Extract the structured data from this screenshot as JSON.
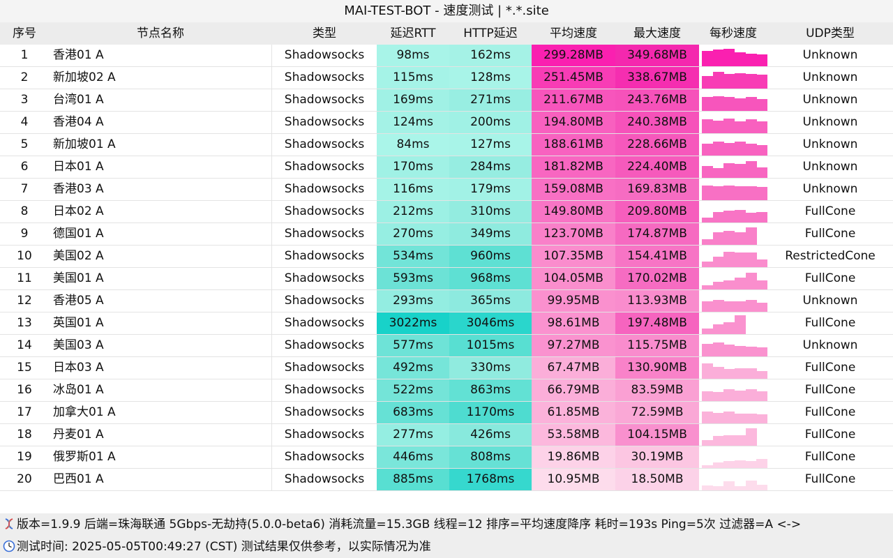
{
  "title": "MAI-TEST-BOT - 速度测试 | *.*.site",
  "headers": {
    "index": "序号",
    "name": "节点名称",
    "type": "类型",
    "rtt": "延迟RTT",
    "http": "HTTP延迟",
    "avg": "平均速度",
    "max": "最大速度",
    "persec": "每秒速度",
    "udp": "UDP类型"
  },
  "rows": [
    {
      "index": "1",
      "name": "香港01 A",
      "type": "Shadowsocks",
      "rtt": "98ms",
      "http": "162ms",
      "avg": "299.28MB",
      "max": "349.68MB",
      "udp": "Unknown",
      "rtt_color": "#a8f4e8",
      "http_color": "#a5f2e6",
      "avg_color": "#fa20b0",
      "max_color": "#f428ae",
      "spark": [
        0.8,
        0.85,
        0.9,
        0.7,
        0.65,
        0.6
      ]
    },
    {
      "index": "2",
      "name": "新加坡02 A",
      "type": "Shadowsocks",
      "rtt": "115ms",
      "http": "128ms",
      "avg": "251.45MB",
      "max": "338.67MB",
      "udp": "Unknown",
      "rtt_color": "#a5f3e7",
      "http_color": "#a8f4e8",
      "avg_color": "#f83cb5",
      "max_color": "#f52eb0",
      "spark": [
        0.65,
        0.85,
        0.75,
        0.8,
        0.75,
        0.7
      ]
    },
    {
      "index": "3",
      "name": "台湾01 A",
      "type": "Shadowsocks",
      "rtt": "169ms",
      "http": "271ms",
      "avg": "211.67MB",
      "max": "243.76MB",
      "udp": "Unknown",
      "rtt_color": "#a0f1e5",
      "http_color": "#98eee2",
      "avg_color": "#f755bc",
      "max_color": "#f652ba",
      "spark": [
        0.7,
        0.75,
        0.7,
        0.65,
        0.7,
        0.6
      ]
    },
    {
      "index": "4",
      "name": "香港04 A",
      "type": "Shadowsocks",
      "rtt": "124ms",
      "http": "200ms",
      "avg": "194.80MB",
      "max": "240.38MB",
      "udp": "Unknown",
      "rtt_color": "#a4f2e6",
      "http_color": "#a0f1e5",
      "avg_color": "#f860bf",
      "max_color": "#f652ba",
      "spark": [
        0.7,
        0.65,
        0.75,
        0.6,
        0.7,
        0.6
      ]
    },
    {
      "index": "5",
      "name": "新加坡01 A",
      "type": "Shadowsocks",
      "rtt": "84ms",
      "http": "127ms",
      "avg": "188.61MB",
      "max": "228.66MB",
      "udp": "Unknown",
      "rtt_color": "#aaf5e9",
      "http_color": "#a8f4e8",
      "avg_color": "#f862c0",
      "max_color": "#f658bc",
      "spark": [
        0.6,
        0.7,
        0.65,
        0.7,
        0.6,
        0.55
      ]
    },
    {
      "index": "6",
      "name": "日本01 A",
      "type": "Shadowsocks",
      "rtt": "170ms",
      "http": "284ms",
      "avg": "181.82MB",
      "max": "224.40MB",
      "udp": "Unknown",
      "rtt_color": "#a0f1e5",
      "http_color": "#96ede1",
      "avg_color": "#f866c1",
      "max_color": "#f65abc",
      "spark": [
        0.6,
        0.5,
        0.75,
        0.7,
        0.85,
        0.55
      ]
    },
    {
      "index": "7",
      "name": "香港03 A",
      "type": "Shadowsocks",
      "rtt": "116ms",
      "http": "179ms",
      "avg": "159.08MB",
      "max": "169.83MB",
      "udp": "Unknown",
      "rtt_color": "#a5f3e7",
      "http_color": "#a2f2e6",
      "avg_color": "#f870c4",
      "max_color": "#f66cc2",
      "spark": [
        0.75,
        0.7,
        0.75,
        0.7,
        0.72,
        0.68
      ]
    },
    {
      "index": "8",
      "name": "日本02 A",
      "type": "Shadowsocks",
      "rtt": "212ms",
      "http": "310ms",
      "avg": "149.80MB",
      "max": "209.80MB",
      "udp": "FullCone",
      "rtt_color": "#9cf0e4",
      "http_color": "#93ece0",
      "avg_color": "#f874c5",
      "max_color": "#f65ebd",
      "spark": [
        0.25,
        0.55,
        0.6,
        0.65,
        0.5,
        0.55
      ]
    },
    {
      "index": "9",
      "name": "德国01 A",
      "type": "Shadowsocks",
      "rtt": "270ms",
      "http": "349ms",
      "avg": "123.70MB",
      "max": "174.87MB",
      "udp": "FullCone",
      "rtt_color": "#96eee2",
      "http_color": "#8febdf",
      "avg_color": "#f980c9",
      "max_color": "#f66ac1",
      "spark": [
        0.3,
        0.65,
        0.7,
        0.65,
        0.9,
        0.0
      ]
    },
    {
      "index": "10",
      "name": "美国02 A",
      "type": "Shadowsocks",
      "rtt": "534ms",
      "http": "960ms",
      "avg": "107.35MB",
      "max": "154.41MB",
      "udp": "RestrictedCone",
      "rtt_color": "#72e4d8",
      "http_color": "#5ee0d3",
      "avg_color": "#fa8ccd",
      "max_color": "#f774c5",
      "spark": [
        0.3,
        0.55,
        0.8,
        0.75,
        0.75,
        0.4
      ]
    },
    {
      "index": "11",
      "name": "美国01 A",
      "type": "Shadowsocks",
      "rtt": "593ms",
      "http": "968ms",
      "avg": "104.05MB",
      "max": "170.02MB",
      "udp": "FullCone",
      "rtt_color": "#6ce2d6",
      "http_color": "#5ee0d3",
      "avg_color": "#fa8ecd",
      "max_color": "#f66cc2",
      "spark": [
        0.2,
        0.4,
        0.45,
        0.6,
        0.85,
        0.45
      ]
    },
    {
      "index": "12",
      "name": "香港05 A",
      "type": "Shadowsocks",
      "rtt": "293ms",
      "http": "365ms",
      "avg": "99.95MB",
      "max": "113.93MB",
      "udp": "Unknown",
      "rtt_color": "#93ede1",
      "http_color": "#8deadf",
      "avg_color": "#fa90ce",
      "max_color": "#f98ccd",
      "spark": [
        0.55,
        0.6,
        0.55,
        0.55,
        0.6,
        0.45
      ]
    },
    {
      "index": "13",
      "name": "英国01 A",
      "type": "Shadowsocks",
      "rtt": "3022ms",
      "http": "3046ms",
      "avg": "98.61MB",
      "max": "197.48MB",
      "udp": "FullCone",
      "rtt_color": "#18d2c9",
      "http_color": "#2ad6cc",
      "avg_color": "#fa92cf",
      "max_color": "#f664bf",
      "spark": [
        0.3,
        0.5,
        0.6,
        0.95,
        0.0,
        0.0
      ]
    },
    {
      "index": "14",
      "name": "美国03 A",
      "type": "Shadowsocks",
      "rtt": "577ms",
      "http": "1015ms",
      "avg": "97.27MB",
      "max": "115.75MB",
      "udp": "Unknown",
      "rtt_color": "#6ee3d7",
      "http_color": "#58dfd2",
      "avg_color": "#fa92cf",
      "max_color": "#f98ccd",
      "spark": [
        0.65,
        0.7,
        0.6,
        0.55,
        0.5,
        0.45
      ]
    },
    {
      "index": "15",
      "name": "日本03 A",
      "type": "Shadowsocks",
      "rtt": "492ms",
      "http": "330ms",
      "avg": "67.47MB",
      "max": "130.90MB",
      "udp": "FullCone",
      "rtt_color": "#76e5d9",
      "http_color": "#90ebdf",
      "avg_color": "#fbaed9",
      "max_color": "#f982c9",
      "spark": [
        0.8,
        0.6,
        0.5,
        0.55,
        0.55,
        0.4
      ]
    },
    {
      "index": "16",
      "name": "冰岛01 A",
      "type": "Shadowsocks",
      "rtt": "522ms",
      "http": "863ms",
      "avg": "66.79MB",
      "max": "83.59MB",
      "udp": "FullCone",
      "rtt_color": "#74e4d8",
      "http_color": "#62e1d4",
      "avg_color": "#fbaed9",
      "max_color": "#faa0d3",
      "spark": [
        0.5,
        0.45,
        0.6,
        0.55,
        0.6,
        0.5
      ]
    },
    {
      "index": "17",
      "name": "加拿大01 A",
      "type": "Shadowsocks",
      "rtt": "683ms",
      "http": "1170ms",
      "avg": "61.85MB",
      "max": "72.59MB",
      "udp": "FullCone",
      "rtt_color": "#66e1d5",
      "http_color": "#4edcd0",
      "avg_color": "#fbb2da",
      "max_color": "#faa8d6",
      "spark": [
        0.6,
        0.55,
        0.6,
        0.5,
        0.5,
        0.45
      ]
    },
    {
      "index": "18",
      "name": "丹麦01 A",
      "type": "Shadowsocks",
      "rtt": "277ms",
      "http": "426ms",
      "avg": "53.58MB",
      "max": "104.15MB",
      "udp": "FullCone",
      "rtt_color": "#95eee2",
      "http_color": "#88e9dd",
      "avg_color": "#fcb8dd",
      "max_color": "#f990ce",
      "spark": [
        0.3,
        0.5,
        0.55,
        0.55,
        0.9,
        0.0
      ]
    },
    {
      "index": "19",
      "name": "俄罗斯01 A",
      "type": "Shadowsocks",
      "rtt": "446ms",
      "http": "808ms",
      "avg": "19.86MB",
      "max": "30.19MB",
      "udp": "FullCone",
      "rtt_color": "#7ae6da",
      "http_color": "#66e1d5",
      "avg_color": "#fdd2e8",
      "max_color": "#fcc6e2",
      "spark": [
        0.15,
        0.3,
        0.35,
        0.4,
        0.35,
        0.45
      ]
    },
    {
      "index": "20",
      "name": "巴西01 A",
      "type": "Shadowsocks",
      "rtt": "885ms",
      "http": "1768ms",
      "avg": "10.95MB",
      "max": "18.50MB",
      "udp": "FullCone",
      "rtt_color": "#58dfd2",
      "http_color": "#36d8ce",
      "avg_color": "#fddcec",
      "max_color": "#fcd2e8",
      "spark": [
        0.25,
        0.2,
        0.45,
        0.2,
        0.5,
        0.3
      ]
    }
  ],
  "footer": {
    "line1": "版本=1.9.9  后端=珠海联通 5Gbps-无劫持(5.0.0-beta6) 消耗流量=15.3GB  线程=12  排序=平均速度降序  耗时=193s  Ping=5次  过滤器=A <->",
    "line2": "测试时间: 2025-05-05T00:49:27 (CST)  测试结果仅供参考，以实际情况为准",
    "icon1": "dna-icon",
    "icon2": "clock-icon"
  },
  "colors": {
    "spark": "#f85cc0",
    "header_bg": "#ececec",
    "footer_bg": "#eeeeee"
  }
}
